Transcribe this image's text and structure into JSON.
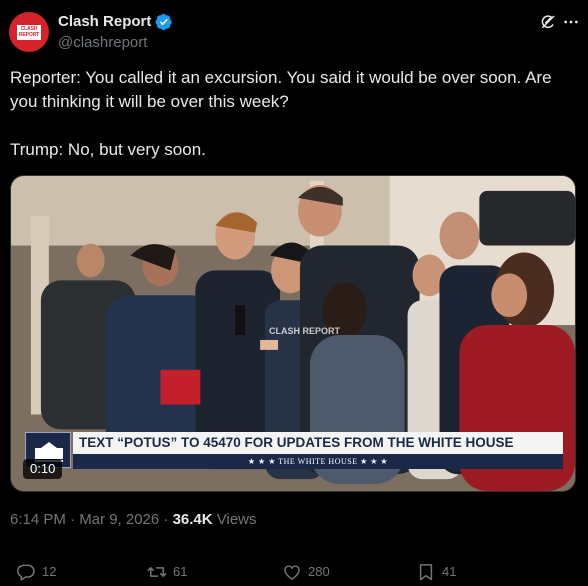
{
  "author": {
    "display_name": "Clash Report",
    "handle": "@clashreport",
    "avatar_text": "CLASH REPORT",
    "verified": true
  },
  "tweet": {
    "text": "Reporter: You called it an excursion. You said it would be over soon. Are you thinking it will be over this week?\n\nTrump: No, but very soon."
  },
  "media": {
    "watermark": "CLASH REPORT",
    "chyron_main": "TEXT “POTUS” TO 45470 FOR UPDATES FROM THE WHITE HOUSE",
    "chyron_sub": "★ ★ ★   THE WHITE HOUSE   ★ ★ ★",
    "duration": "0:10"
  },
  "meta": {
    "timestamp": "6:14 PM · Mar 9, 2026 · ",
    "views_count": "36.4K",
    "views_label": " Views"
  },
  "actions": {
    "replies": "12",
    "reposts": "61",
    "likes": "280",
    "bookmarks": "41"
  },
  "colors": {
    "background": "#000000",
    "text_primary": "#e7e9ea",
    "text_secondary": "#71767b",
    "verified_blue": "#1d9bf0",
    "avatar_red": "#d6232a"
  }
}
